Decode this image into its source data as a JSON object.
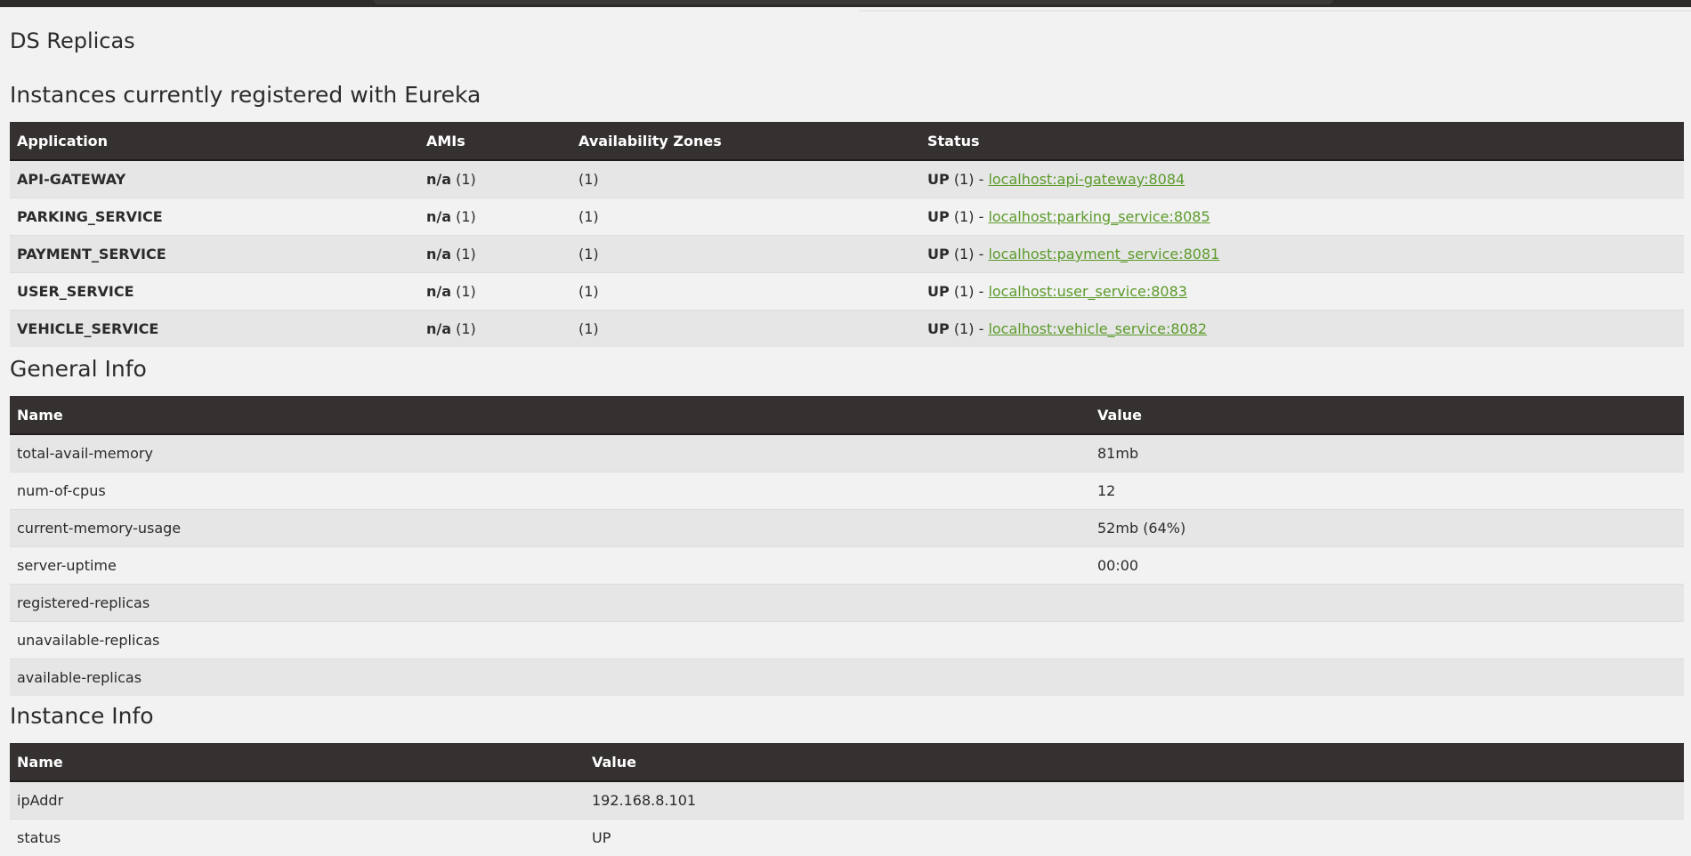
{
  "page_title": "DS Replicas",
  "instances": {
    "title": "Instances currently registered with Eureka",
    "headers": [
      "Application",
      "AMIs",
      "Availability Zones",
      "Status"
    ],
    "rows": [
      {
        "app": "API-GATEWAY",
        "ami_label": "n/a",
        "ami_count": "(1)",
        "zones": "(1)",
        "status": "UP",
        "status_count": "(1) -",
        "link": "localhost:api-gateway:8084"
      },
      {
        "app": "PARKING_SERVICE",
        "ami_label": "n/a",
        "ami_count": "(1)",
        "zones": "(1)",
        "status": "UP",
        "status_count": "(1) -",
        "link": "localhost:parking_service:8085"
      },
      {
        "app": "PAYMENT_SERVICE",
        "ami_label": "n/a",
        "ami_count": "(1)",
        "zones": "(1)",
        "status": "UP",
        "status_count": "(1) -",
        "link": "localhost:payment_service:8081"
      },
      {
        "app": "USER_SERVICE",
        "ami_label": "n/a",
        "ami_count": "(1)",
        "zones": "(1)",
        "status": "UP",
        "status_count": "(1) -",
        "link": "localhost:user_service:8083"
      },
      {
        "app": "VEHICLE_SERVICE",
        "ami_label": "n/a",
        "ami_count": "(1)",
        "zones": "(1)",
        "status": "UP",
        "status_count": "(1) -",
        "link": "localhost:vehicle_service:8082"
      }
    ]
  },
  "general_info": {
    "title": "General Info",
    "headers": [
      "Name",
      "Value"
    ],
    "rows": [
      {
        "name": "total-avail-memory",
        "value": "81mb"
      },
      {
        "name": "num-of-cpus",
        "value": "12"
      },
      {
        "name": "current-memory-usage",
        "value": "52mb (64%)"
      },
      {
        "name": "server-uptime",
        "value": "00:00"
      },
      {
        "name": "registered-replicas",
        "value": ""
      },
      {
        "name": "unavailable-replicas",
        "value": ""
      },
      {
        "name": "available-replicas",
        "value": ""
      }
    ]
  },
  "instance_info": {
    "title": "Instance Info",
    "headers": [
      "Name",
      "Value"
    ],
    "rows": [
      {
        "name": "ipAddr",
        "value": "192.168.8.101"
      },
      {
        "name": "status",
        "value": "UP"
      }
    ]
  },
  "colors": {
    "header_bg": "#353130",
    "link": "#5b9a2a",
    "row_odd": "#e6e6e6",
    "row_even": "#f2f2f2"
  }
}
